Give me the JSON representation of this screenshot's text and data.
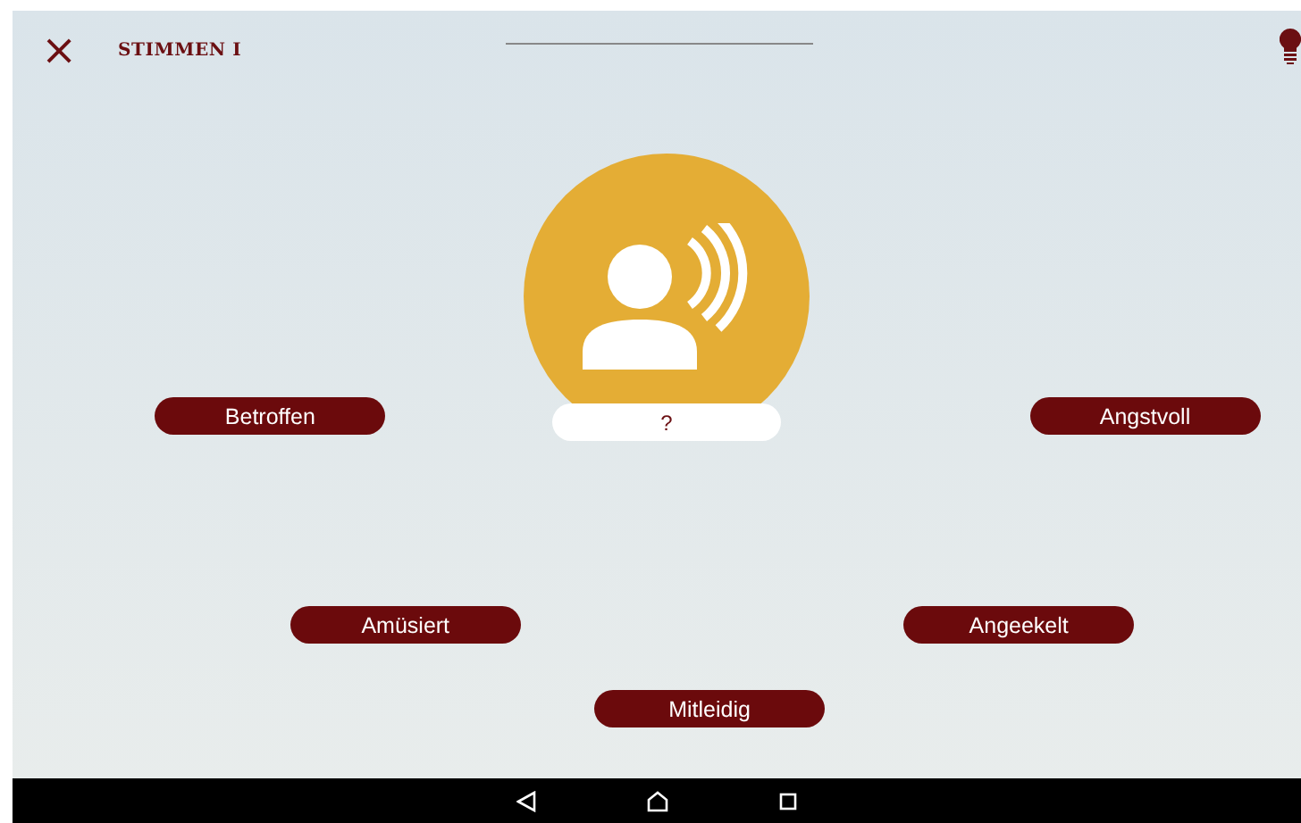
{
  "header": {
    "close": "×",
    "title": "STIMMEN I"
  },
  "answer": "?",
  "options": [
    "Betroffen",
    "Angstvoll",
    "Amüsiert",
    "Angeekelt",
    "Mitleidig"
  ]
}
